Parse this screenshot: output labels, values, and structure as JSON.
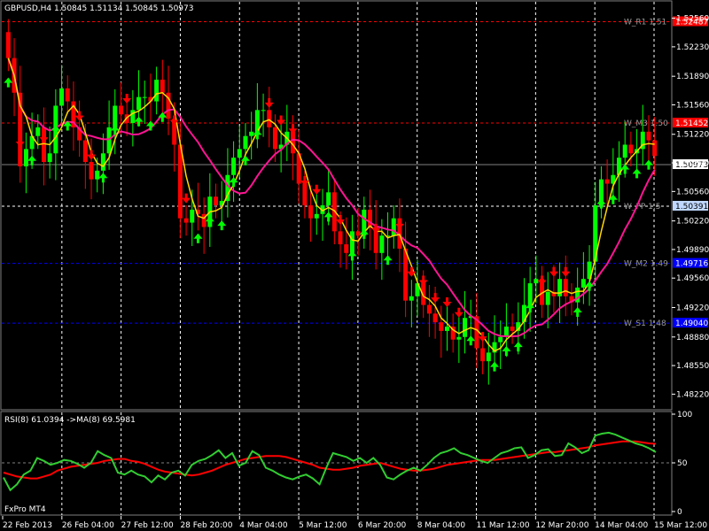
{
  "window": {
    "title": "GBPUSD,H4  1.50845 1.51134 1.50845 1.50973",
    "watermark": "FxPro MT4"
  },
  "colors": {
    "background": "#000000",
    "bull": "#00ff00",
    "bear": "#ff0000",
    "ma_fast": "#ffd700",
    "ma_slow": "#ff1493",
    "rsi": "#32cd32",
    "rsi_ma": "#ff0000",
    "pivot": "#ff0000",
    "mid_level": "#0000ff"
  },
  "chart_data": [
    {
      "type": "candlestick",
      "title": "GBPUSD,H4",
      "ohlc_header": "1.50845 1.51134 1.50845 1.50973",
      "yticks": [
        "1.52560",
        "1.52230",
        "1.51890",
        "1.51560",
        "1.51220",
        "1.50890",
        "1.50560",
        "1.50220",
        "1.49890",
        "1.49560",
        "1.49220",
        "1.48880",
        "1.48550",
        "1.48220"
      ],
      "ylim": [
        1.4805,
        1.5275
      ],
      "current_price": "1.50973",
      "xticks": [
        "22 Feb 2013",
        "26 Feb 04:00",
        "27 Feb 12:00",
        "28 Feb 20:00",
        "4 Mar 04:00",
        "5 Mar 12:00",
        "6 Mar 20:00",
        "8 Mar 04:00",
        "11 Mar 12:00",
        "12 Mar 20:00",
        "14 Mar 04:00",
        "15 Mar 12:00"
      ],
      "levels": [
        {
          "name": "W_R1",
          "label": "W_R1 1.51",
          "price": 1.5252,
          "price_label": "1.52487",
          "style": "red"
        },
        {
          "name": "W_M3",
          "label": "W_M3 1.50",
          "price": 1.5135,
          "price_label": "1.51452",
          "style": "red"
        },
        {
          "name": "W_PP",
          "label": "W_PP 1.5",
          "price": 1.5039,
          "price_label": "1.50391",
          "style": "white"
        },
        {
          "name": "W_M2",
          "label": "W_M2 1.49",
          "price": 1.4973,
          "price_label": "1.49716",
          "style": "blue"
        },
        {
          "name": "W_S1",
          "label": "W_S1 1.48",
          "price": 1.4904,
          "price_label": "1.49040",
          "style": "blue"
        }
      ],
      "closes": [
        1.521,
        1.517,
        1.5085,
        1.5105,
        1.512,
        1.513,
        1.509,
        1.51,
        1.5155,
        1.5175,
        1.516,
        1.513,
        1.5115,
        1.509,
        1.507,
        1.508,
        1.51,
        1.513,
        1.5155,
        1.5145,
        1.5135,
        1.515,
        1.5165,
        1.5165,
        1.516,
        1.5185,
        1.517,
        1.514,
        1.511,
        1.5025,
        1.502,
        1.5035,
        1.503,
        1.5015,
        1.505,
        1.504,
        1.5045,
        1.5075,
        1.5095,
        1.5105,
        1.512,
        1.5125,
        1.515,
        1.515,
        1.513,
        1.5105,
        1.511,
        1.5125,
        1.51,
        1.5065,
        1.504,
        1.5025,
        1.503,
        1.504,
        1.5055,
        1.501,
        1.4995,
        1.4985,
        1.501,
        1.5005,
        1.5035,
        1.5015,
        1.4985,
        1.5005,
        1.5005,
        1.5025,
        1.499,
        1.493,
        1.4935,
        1.495,
        1.4925,
        1.4915,
        1.4905,
        1.4895,
        1.49,
        1.4885,
        1.4888,
        1.491,
        1.4912,
        1.4875,
        1.486,
        1.487,
        1.4882,
        1.4888,
        1.49,
        1.4895,
        1.4905,
        1.4925,
        1.495,
        1.4955,
        1.4925,
        1.494,
        1.4935,
        1.4955,
        1.4935,
        1.4928,
        1.4945,
        1.4955,
        1.4975,
        1.504,
        1.507,
        1.5065,
        1.5075,
        1.5095,
        1.511,
        1.51,
        1.5105,
        1.5125,
        1.5115,
        1.5097
      ]
    },
    {
      "type": "line",
      "title": "RSI(8) 61.0394  ->MA(8) 69.5981",
      "yticks": [
        "100",
        "50",
        "0"
      ],
      "ylim": [
        0,
        100
      ],
      "series": [
        {
          "name": "RSI(8)",
          "values": [
            35,
            22,
            28,
            38,
            42,
            55,
            52,
            48,
            50,
            53,
            52,
            49,
            45,
            50,
            62,
            58,
            55,
            40,
            38,
            42,
            38,
            36,
            30,
            37,
            33,
            40,
            42,
            37,
            48,
            52,
            54,
            58,
            63,
            55,
            60,
            47,
            50,
            62,
            58,
            45,
            42,
            38,
            35,
            33,
            36,
            38,
            34,
            28,
            45,
            60,
            58,
            56,
            52,
            55,
            50,
            55,
            48,
            35,
            33,
            38,
            42,
            45,
            42,
            48,
            55,
            60,
            62,
            65,
            60,
            58,
            55,
            52,
            50,
            55,
            60,
            62,
            65,
            66,
            55,
            58,
            63,
            64,
            57,
            58,
            70,
            66,
            60,
            63,
            78,
            80,
            81,
            79,
            76,
            73,
            70,
            68,
            65,
            61
          ]
        },
        {
          "name": "MA(8)",
          "values": [
            40,
            38,
            36,
            35,
            34,
            34,
            36,
            38,
            42,
            44,
            46,
            47,
            48,
            49,
            50,
            52,
            53,
            54,
            54,
            52,
            51,
            49,
            46,
            43,
            41,
            40,
            39,
            38,
            37,
            38,
            40,
            42,
            45,
            48,
            50,
            52,
            54,
            55,
            56,
            57,
            57,
            57,
            56,
            54,
            52,
            50,
            48,
            45,
            44,
            43,
            43,
            44,
            45,
            47,
            48,
            49,
            50,
            48,
            46,
            44,
            43,
            42,
            42,
            43,
            44,
            46,
            48,
            49,
            50,
            51,
            52,
            53,
            53,
            53,
            54,
            55,
            56,
            57,
            58,
            59,
            60,
            61,
            61,
            62,
            63,
            64,
            65,
            66,
            68,
            69,
            70,
            71,
            72,
            72,
            72,
            71,
            70,
            69.6
          ]
        }
      ]
    }
  ]
}
